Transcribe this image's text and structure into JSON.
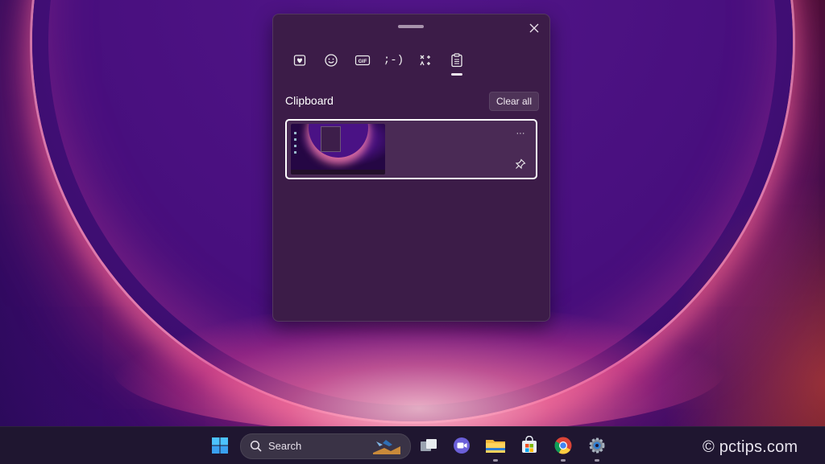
{
  "panel": {
    "close_label": "✕",
    "tabs": [
      {
        "name": "recent-favorites",
        "icon": "heart-card-icon"
      },
      {
        "name": "emoji",
        "icon": "smiley-icon"
      },
      {
        "name": "gif",
        "icon": "gif-icon",
        "text": "GIF"
      },
      {
        "name": "kaomoji",
        "icon": "kaomoji-icon",
        "text": ";-)"
      },
      {
        "name": "symbols",
        "icon": "symbols-icon"
      },
      {
        "name": "clipboard",
        "icon": "clipboard-icon",
        "active": true
      }
    ],
    "section_title": "Clipboard",
    "clear_all_label": "Clear all",
    "items": [
      {
        "type": "image",
        "more_label": "···"
      }
    ]
  },
  "taskbar": {
    "search_label": "Search",
    "apps": [
      "start-icon",
      "task-view-icon",
      "meet-icon",
      "file-explorer-icon",
      "store-icon",
      "chrome-icon",
      "settings-icon"
    ]
  },
  "watermark": "© pctips.com",
  "colors": {
    "panel_bg": "#3c1c48",
    "accent_underline": "#f0e6f0",
    "taskbar_bg": "#1f1630"
  }
}
